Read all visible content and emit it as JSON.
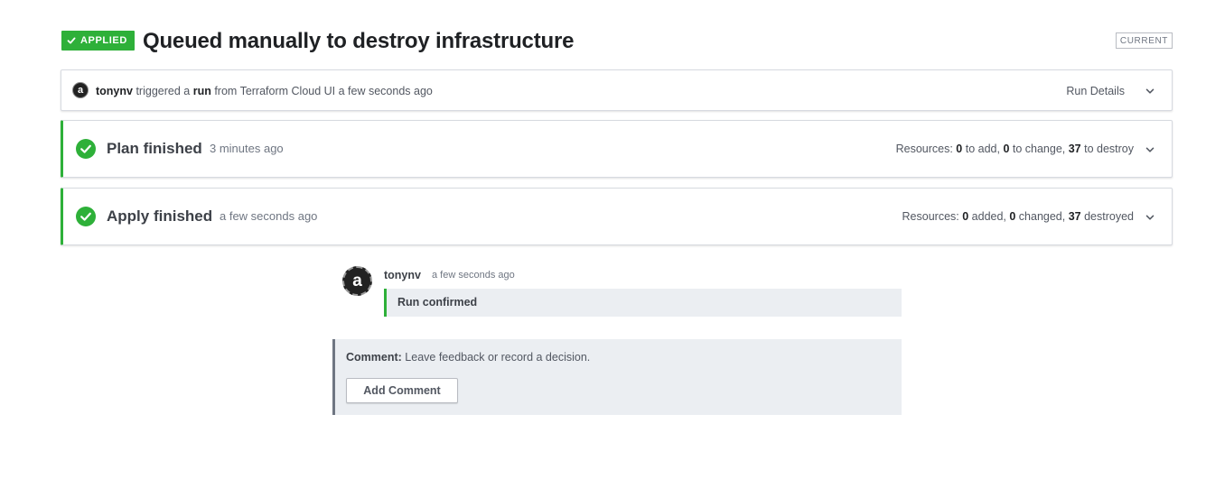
{
  "header": {
    "status_badge": "APPLIED",
    "title": "Queued manually to destroy infrastructure",
    "current_badge": "CURRENT"
  },
  "trigger": {
    "avatar_letter": "a",
    "user": "tonynv",
    "text_1": " triggered a ",
    "run_word": "run",
    "text_2": " from Terraform Cloud UI a few seconds ago",
    "details_label": "Run Details"
  },
  "plan": {
    "title": "Plan finished",
    "time": "3 minutes ago",
    "resources_label": "Resources: ",
    "add": "0",
    "add_label": " to add, ",
    "change": "0",
    "change_label": " to change, ",
    "destroy": "37",
    "destroy_label": " to destroy"
  },
  "apply": {
    "title": "Apply finished",
    "time": "a few seconds ago",
    "resources_label": "Resources: ",
    "added": "0",
    "added_label": " added, ",
    "changed": "0",
    "changed_label": " changed, ",
    "destroyed": "37",
    "destroyed_label": " destroyed"
  },
  "event": {
    "avatar_letter": "a",
    "user": "tonynv",
    "time": "a few seconds ago",
    "message": "Run confirmed"
  },
  "comment": {
    "label": "Comment:",
    "text": " Leave feedback or record a decision.",
    "button": "Add Comment"
  },
  "colors": {
    "success": "#2eb039",
    "neutral_border": "#6f7682",
    "panel_bg": "#ebeef2"
  },
  "icons": {
    "status": "checkmark-icon",
    "phase": "check-circle-icon",
    "expand": "chevron-down-icon"
  }
}
